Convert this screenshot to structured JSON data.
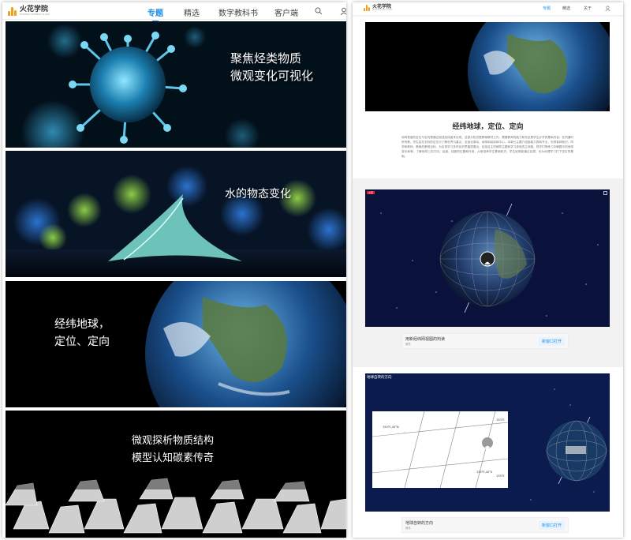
{
  "left": {
    "brand": {
      "name": "火花学院",
      "sub": "HUOHUA SCIENCE CLASS"
    },
    "nav": [
      "专题",
      "精选",
      "数字教科书",
      "客户端"
    ],
    "banners": [
      {
        "lines": [
          "聚焦烃类物质",
          "微观变化可视化"
        ]
      },
      {
        "lines": [
          "水的物态变化"
        ]
      },
      {
        "lines": [
          "经纬地球，",
          "定位、定向"
        ]
      },
      {
        "lines": [
          "微观探析物质结构",
          "模型认知碳素传奇"
        ]
      }
    ]
  },
  "right": {
    "brand": {
      "name": "火花学院",
      "sub": "HUOHUA SCIENCE CLASS"
    },
    "nav": [
      "专题",
      "精选",
      "关于"
    ],
    "title": "经纬地球，定位、定向",
    "description": "地球表面的定位与定向是通过描述经纬度来实现。这部分知识是教案教材之内，需要教师的能力和充足是学生必学的基础内容。在同通时所有教，学生会在实际的定位中了解世界与重点。至适合原动，地球和经纬网中心，本单元主要介绍各能力表和专业，也带各种知识，同学和教师，教案的教育目标，为实现学习多样化的思路提要出，包括自主的辅导主题和学习体验的主体路，同学们等练习中解题中的地球变化和等，了解地球上的方向、经度、纬度的位置和作用，从而培养学生基础知识，学生经常能通过目提，也为地理学习打下坚实的基础。",
    "items": [
      {
        "title": "用新经纬网视图的判读",
        "sub": "微件",
        "button": "新窗口打开",
        "badge": "火花"
      },
      {
        "title": "地球自转的方向",
        "sub": "微件",
        "button": "新窗口打开",
        "overlay_title": "地球自转的方向"
      }
    ],
    "coords": [
      "150°E,45°N",
      "150°E",
      "135°E,45°S",
      "135°E"
    ]
  }
}
